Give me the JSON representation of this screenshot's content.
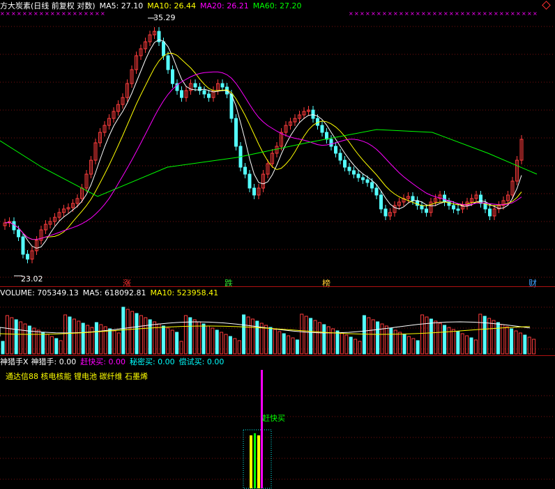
{
  "main": {
    "title": "方大炭素(日线 前复权 对数)",
    "ma5": "MA5: 27.10",
    "ma10": "MA10: 26.44",
    "ma20": "MA20: 26.21",
    "ma60": "MA60: 27.20",
    "high_label": "35.29",
    "low_label": "23.02",
    "markers": [
      {
        "text": "涨",
        "color": "#ff3030"
      },
      {
        "text": "跌",
        "color": "#30e030"
      },
      {
        "text": "榜",
        "color": "#ffcc33"
      },
      {
        "text": "财",
        "color": "#40a0ff"
      }
    ]
  },
  "volume": {
    "label": "VOLUME: 705349.13",
    "ma5": "MA5: 618092.81",
    "ma10": "MA10: 523958.41"
  },
  "indicator": {
    "name": "神猎手X",
    "value": "神猎手: 0.00",
    "gankuai": "赶快买: 0.00",
    "mimi": "秘密买: 0.00",
    "changshi": "偿试买: 0.00",
    "concepts": "通达信88 核电核能 锂电池 碳纤维 石墨烯",
    "signal_label": "赶快买"
  },
  "colors": {
    "up": "#ff3c3c",
    "down": "#54ffff",
    "ma5": "#ffffff",
    "ma10": "#ffff00",
    "ma20": "#ff00ff",
    "ma60": "#00ff00",
    "magenta": "#ff00ff",
    "signal_yellow": "#ffff00",
    "signal_green": "#00ff00"
  },
  "icons": {
    "diamond": "diamond-icon"
  }
}
